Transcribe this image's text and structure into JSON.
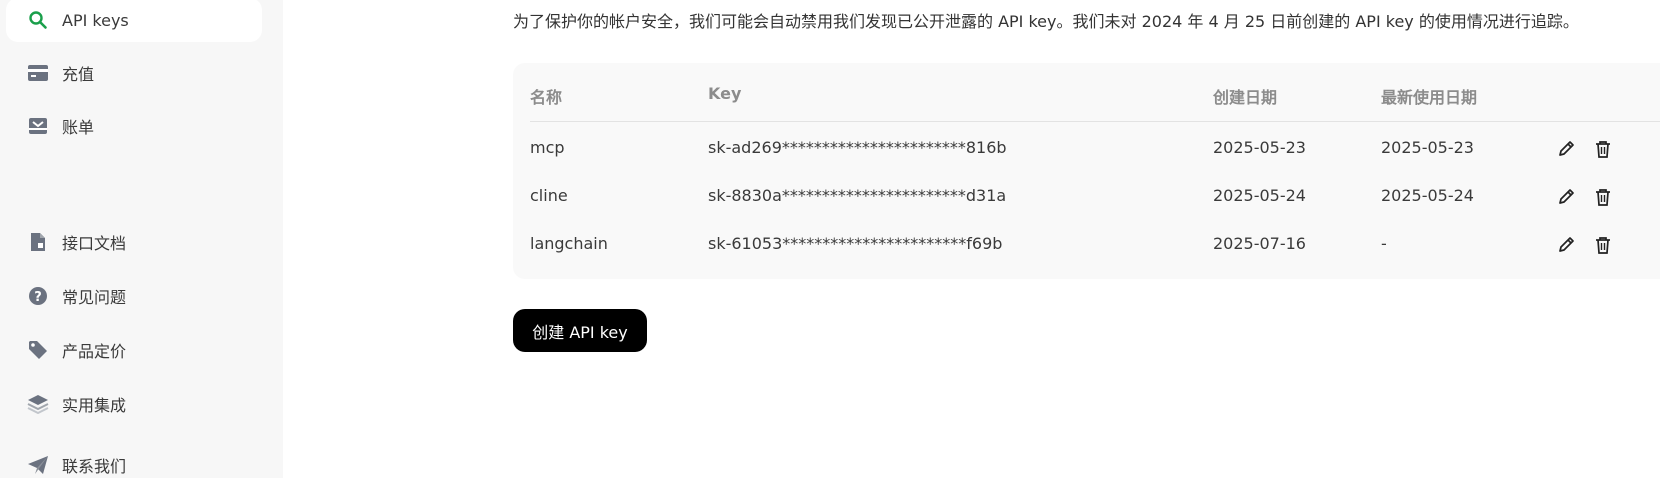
{
  "sidebar": {
    "items": [
      {
        "label": "API keys",
        "icon": "search-icon",
        "active": true
      },
      {
        "label": "充值",
        "icon": "wallet-icon"
      },
      {
        "label": "账单",
        "icon": "inbox-icon"
      },
      {
        "label": "接口文档",
        "icon": "document-icon"
      },
      {
        "label": "常见问题",
        "icon": "question-icon"
      },
      {
        "label": "产品定价",
        "icon": "tag-icon"
      },
      {
        "label": "实用集成",
        "icon": "layers-icon"
      },
      {
        "label": "联系我们",
        "icon": "send-icon"
      }
    ]
  },
  "notice": "为了保护你的帐户安全，我们可能会自动禁用我们发现已公开泄露的 API key。我们未对 2024 年 4 月 25 日前创建的 API key 的使用情况进行追踪。",
  "table": {
    "headers": {
      "name": "名称",
      "key": "Key",
      "created": "创建日期",
      "last_used": "最新使用日期"
    },
    "rows": [
      {
        "name": "mcp",
        "key": "sk-ad269***********************816b",
        "created": "2025-05-23",
        "last_used": "2025-05-23"
      },
      {
        "name": "cline",
        "key": "sk-8830a***********************d31a",
        "created": "2025-05-24",
        "last_used": "2025-05-24"
      },
      {
        "name": "langchain",
        "key": "sk-61053***********************f69b",
        "created": "2025-07-16",
        "last_used": "-"
      }
    ]
  },
  "create_button": "创建 API key",
  "colors": {
    "accent_green": "#1a9f4b",
    "icon_gray": "#6b7280",
    "button_black": "#000000"
  }
}
